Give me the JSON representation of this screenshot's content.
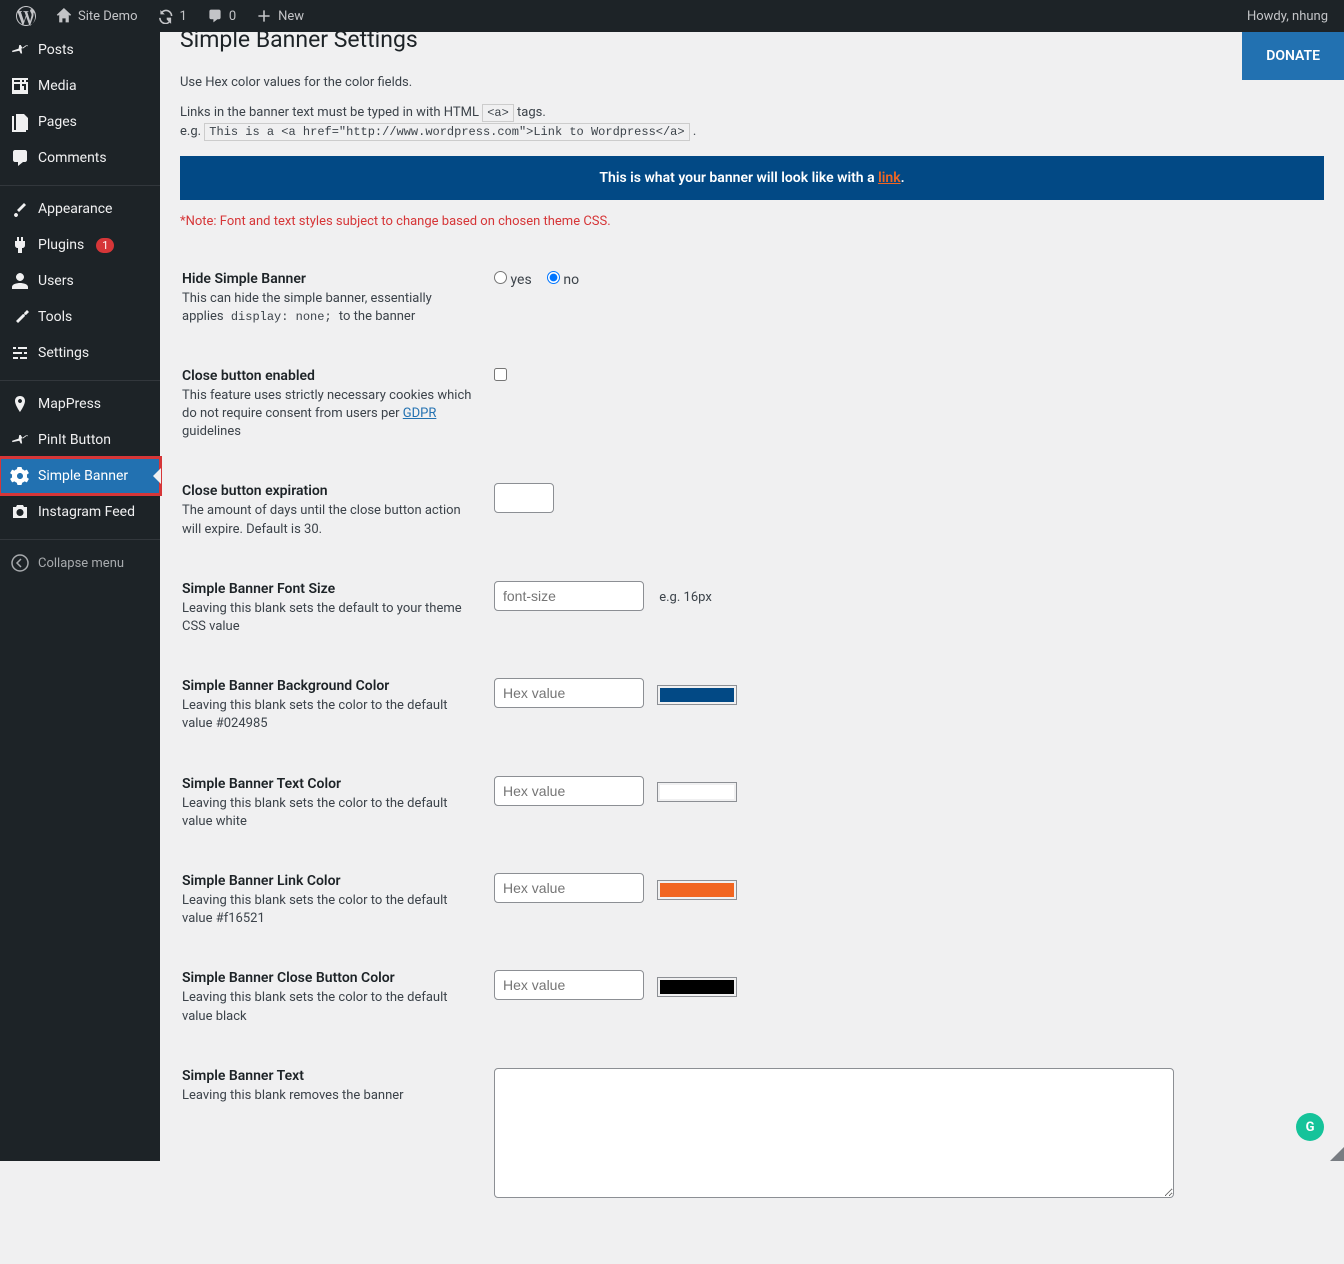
{
  "adminbar": {
    "site_name": "Site Demo",
    "refresh_count": "1",
    "comments_count": "0",
    "new_label": "New",
    "howdy": "Howdy, nhung"
  },
  "sidebar": {
    "posts": "Posts",
    "media": "Media",
    "pages": "Pages",
    "comments": "Comments",
    "appearance": "Appearance",
    "plugins": "Plugins",
    "plugins_badge": "1",
    "users": "Users",
    "tools": "Tools",
    "settings": "Settings",
    "mappress": "MapPress",
    "pinit": "PinIt Button",
    "simple_banner": "Simple Banner",
    "instagram": "Instagram Feed",
    "collapse": "Collapse menu"
  },
  "page": {
    "title": "Simple Banner Settings",
    "donate": "DONATE",
    "intro1": "Use Hex color values for the color fields.",
    "intro2_prefix": "Links in the banner text must be typed in with HTML",
    "intro2_code": "<a>",
    "intro2_suffix": "tags.",
    "intro3_prefix": "e.g.",
    "intro3_code": "This is a <a href=\"http://www.wordpress.com\">Link to Wordpress</a>",
    "intro3_suffix": ".",
    "banner_preview_text": "This is what your banner will look like with a ",
    "banner_preview_link": "link",
    "note": "*Note: Font and text styles subject to change based on chosen theme CSS."
  },
  "fields": {
    "hide": {
      "label": "Hide Simple Banner",
      "desc_prefix": "This can hide the simple banner, essentially applies",
      "desc_code": "display: none;",
      "desc_suffix": "to the banner",
      "yes": "yes",
      "no": "no"
    },
    "close_btn": {
      "label": "Close button enabled",
      "desc_prefix": "This feature uses strictly necessary cookies which do not require consent from users per",
      "desc_link": "GDPR",
      "desc_suffix": "guidelines"
    },
    "close_exp": {
      "label": "Close button expiration",
      "desc": "The amount of days until the close button action will expire. Default is 30."
    },
    "font_size": {
      "label": "Simple Banner Font Size",
      "desc": "Leaving this blank sets the default to your theme CSS value",
      "placeholder": "font-size",
      "hint": "e.g. 16px"
    },
    "bg_color": {
      "label": "Simple Banner Background Color",
      "desc": "Leaving this blank sets the color to the default value #024985",
      "placeholder": "Hex value",
      "swatch": "#024985"
    },
    "text_color": {
      "label": "Simple Banner Text Color",
      "desc": "Leaving this blank sets the color to the default value white",
      "placeholder": "Hex value",
      "swatch": "#ffffff"
    },
    "link_color": {
      "label": "Simple Banner Link Color",
      "desc": "Leaving this blank sets the color to the default value #f16521",
      "placeholder": "Hex value",
      "swatch": "#f16521"
    },
    "close_color": {
      "label": "Simple Banner Close Button Color",
      "desc": "Leaving this blank sets the color to the default value black",
      "placeholder": "Hex value",
      "swatch": "#000000"
    },
    "banner_text": {
      "label": "Simple Banner Text",
      "desc": "Leaving this blank removes the banner"
    }
  }
}
